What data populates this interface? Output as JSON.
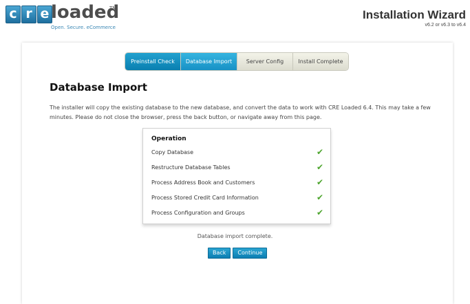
{
  "logo": {
    "letters": [
      "c",
      "r",
      "e"
    ],
    "word": "loaded",
    "tm": "TM",
    "tagline": "Open. Secure. eCommerce"
  },
  "header": {
    "title": "Installation Wizard",
    "version": "v6.2 or v6.3 to v6.4"
  },
  "steps": [
    {
      "label": "Preinstall Check",
      "state": "done"
    },
    {
      "label": "Database Import",
      "state": "active"
    },
    {
      "label": "Server Config",
      "state": "todo"
    },
    {
      "label": "Install Complete",
      "state": "todo"
    }
  ],
  "main": {
    "heading": "Database Import",
    "description": "The installer will copy the existing database to the new database, and convert the data to work with CRE Loaded 6.4. This may take a few minutes. Please do not close the browser, press the back button, or navigate away from this page."
  },
  "operations": {
    "header": "Operation",
    "items": [
      {
        "label": "Copy Database",
        "status": "✔"
      },
      {
        "label": "Restructure Database Tables",
        "status": "✔"
      },
      {
        "label": "Process Address Book and Customers",
        "status": "✔"
      },
      {
        "label": "Process Stored Credit Card Information",
        "status": "✔"
      },
      {
        "label": "Process Configuration and Groups",
        "status": "✔"
      }
    ]
  },
  "status_text": "Database import complete.",
  "buttons": {
    "back": "Back",
    "continue": "Continue"
  },
  "colors": {
    "accent": "#1791c5",
    "check": "#4da52e"
  }
}
